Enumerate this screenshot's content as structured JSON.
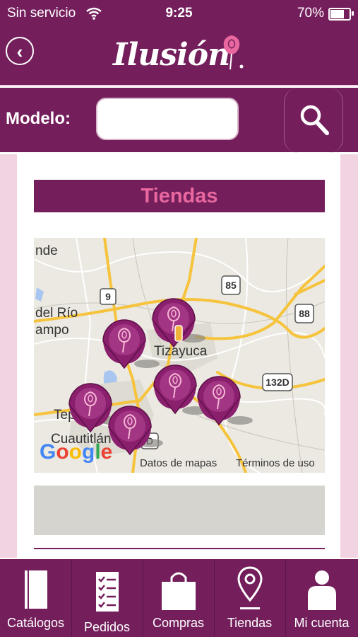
{
  "status_bar": {
    "carrier": "Sin servicio",
    "time": "9:25",
    "battery": "70%"
  },
  "header": {
    "logo_text": "Ilusión"
  },
  "search": {
    "label": "Modelo:",
    "value": "",
    "placeholder": ""
  },
  "section": {
    "title": "Tiendas"
  },
  "map": {
    "places": [
      "nde",
      "del Río",
      "ampo",
      "Tizayuca",
      "Tep",
      "Cuautitlán"
    ],
    "road_shields": [
      "9",
      "85",
      "88",
      "132D",
      "D"
    ],
    "google_logo": "Google",
    "attribution_data": "Datos de mapas",
    "attribution_terms": "Términos de uso",
    "marker_count": 6
  },
  "tabbar": {
    "items": [
      {
        "label": "Catálogos",
        "icon": "book-icon"
      },
      {
        "label": "Pedidos",
        "icon": "checklist-icon"
      },
      {
        "label": "Compras",
        "icon": "shopping-bag-icon"
      },
      {
        "label": "Tiendas",
        "icon": "map-pin-icon"
      },
      {
        "label": "Mi cuenta",
        "icon": "user-icon"
      }
    ]
  },
  "colors": {
    "brand": "#741f5c",
    "accent": "#e8689f",
    "background": "#f2d3e1"
  }
}
